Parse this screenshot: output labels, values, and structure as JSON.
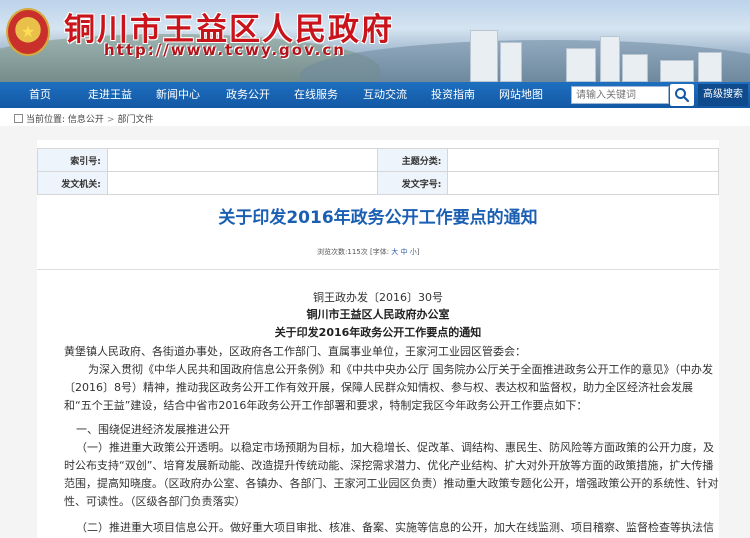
{
  "site": {
    "title": "铜川市王益区人民政府",
    "url": "http://www.tcwy.gov.cn"
  },
  "nav": {
    "items": [
      "首页",
      "走进王益",
      "新闻中心",
      "政务公开",
      "在线服务",
      "互动交流",
      "投资指南",
      "网站地图"
    ],
    "search_placeholder": "请输入关键词",
    "advanced_search": "高级搜索",
    "search_icon": "search-icon"
  },
  "breadcrumb": {
    "label": "当前位置:",
    "items": [
      "信息公开",
      "部门文件"
    ],
    "separator": ">"
  },
  "meta": {
    "index_label": "索引号:",
    "index_value": "",
    "category_label": "主题分类:",
    "category_value": "",
    "issuer_label": "发文机关:",
    "issuer_value": "",
    "docno_label": "发文字号:",
    "docno_value": ""
  },
  "article": {
    "title": "关于印发2016年政务公开工作要点的通知",
    "views_label": "浏览次数:",
    "views": "115次",
    "font_label": "[字体:",
    "font_sizes": [
      "大",
      "中",
      "小"
    ],
    "font_close": "]",
    "doc_number": "铜王政办发〔2016〕30号",
    "issuer": "铜川市王益区人民政府办公室",
    "subtitle": "关于印发2016年政务公开工作要点的通知",
    "paragraphs": [
      "黄堡镇人民政府、各街道办事处，区政府各工作部门、直属事业单位，王家河工业园区管委会：",
      "为深入贯彻《中华人民共和国政府信息公开条例》和《中共中央办公厅 国务院办公厅关于全面推进政务公开工作的意见》（中办发〔2016〕8号）精神，推动我区政务公开工作有效开展，保障人民群众知情权、参与权、表达权和监督权，助力全区经济社会发展和“五个王益”建设，结合中省市2016年政务公开工作部署和要求，特制定我区今年政务公开工作要点如下：",
      "一、围绕促进经济发展推进公开",
      "（一）推进重大政策公开透明。以稳定市场预期为目标，加大稳增长、促改革、调结构、惠民生、防风险等方面政策的公开力度，及时公布支持“双创”、培育发展新动能、改造提升传统动能、深挖需求潜力、优化产业结构、扩大对外开放等方面的政策措施，扩大传播范围，提高知晓度。（区政府办公室、各镇办、各部门、王家河工业园区负责）推动重大政策专题化公开，增强政策公开的系统性、针对性、可读性。（区级各部门负责落实）",
      "（二）推进重大项目信息公开。做好重大项目审批、核准、备案、实施等信息的公开，加大在线监测、项目稽察、监督检查等执法信"
    ]
  },
  "colors": {
    "nav_blue": "#1660ae",
    "title_red": "#c8141a",
    "doc_title_blue": "#1b5fb3"
  }
}
